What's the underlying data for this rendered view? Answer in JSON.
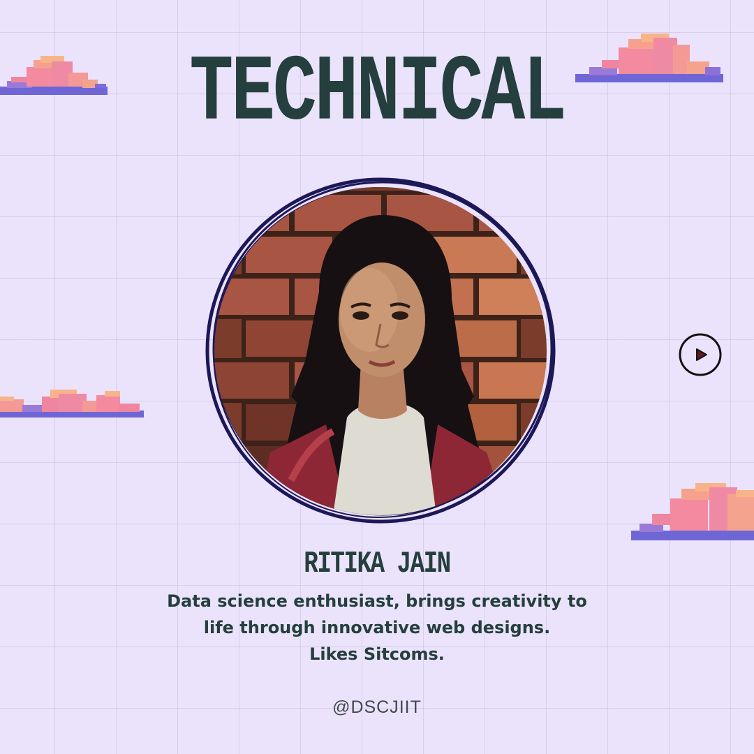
{
  "title": "TECHNICAL",
  "profile": {
    "name": "RITIKA JAIN",
    "bio_lines": [
      "Data science enthusiast, brings creativity to",
      "life through innovative web designs.",
      "Likes Sitcoms."
    ]
  },
  "handle": "@DSCJIIT",
  "controls": {
    "play_icon": "play-icon"
  },
  "colors": {
    "background": "#ebe3fb",
    "text": "#243f3d",
    "ring": "#1c1858",
    "cloud_pink": "#f48aa0",
    "cloud_peach": "#f7b283",
    "cloud_purple": "#6c69d8"
  }
}
